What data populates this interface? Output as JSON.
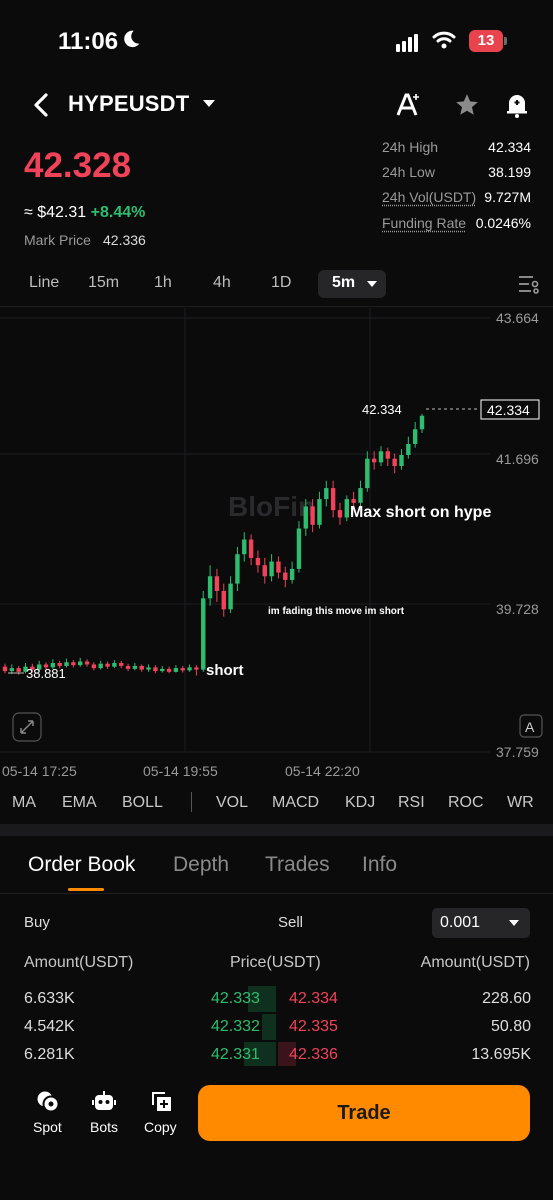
{
  "status_bar": {
    "time": "11:06",
    "battery": "13"
  },
  "header": {
    "pair": "HYPEUSDT"
  },
  "ticker": {
    "last_price": "42.328",
    "usd_prefix": "≈ $42.31",
    "change_pct": "+8.44%",
    "mark_price_label": "Mark Price",
    "mark_price": "42.336"
  },
  "stats": [
    {
      "label": "24h High",
      "value": "42.334"
    },
    {
      "label": "24h Low",
      "value": "38.199"
    },
    {
      "label": "24h Vol(USDT)",
      "value": "9.727M"
    },
    {
      "label": "Funding Rate",
      "value": "0.0246%"
    }
  ],
  "timeframes": [
    "Line",
    "15m",
    "1h",
    "4h",
    "1D"
  ],
  "timeframe_active": "5m",
  "chart_data": {
    "type": "candlestick",
    "y_ticks": [
      "43.664",
      "41.696",
      "39.728",
      "37.759"
    ],
    "x_ticks": [
      "05-14 17:25",
      "05-14 19:55",
      "05-14 22:20"
    ],
    "last_price_label": "42.334",
    "current_price_tag": "42.334",
    "low_label": "38.881",
    "watermark": "BloFin",
    "annotations": [
      "Max short on hype",
      "im fading this move im short",
      "short"
    ],
    "ylim": [
      37.759,
      43.664
    ],
    "candles": [
      [
        38.92,
        38.86,
        38.96,
        38.83
      ],
      [
        38.86,
        38.9,
        38.95,
        38.82
      ],
      [
        38.9,
        38.85,
        38.93,
        38.81
      ],
      [
        38.85,
        38.92,
        38.97,
        38.83
      ],
      [
        38.92,
        38.88,
        38.96,
        38.84
      ],
      [
        38.88,
        38.95,
        39.0,
        38.86
      ],
      [
        38.95,
        38.91,
        38.98,
        38.88
      ],
      [
        38.91,
        38.97,
        39.02,
        38.89
      ],
      [
        38.97,
        38.93,
        39.0,
        38.9
      ],
      [
        38.93,
        38.98,
        39.03,
        38.91
      ],
      [
        38.98,
        38.94,
        39.01,
        38.91
      ],
      [
        38.94,
        38.99,
        39.04,
        38.92
      ],
      [
        38.99,
        38.95,
        39.02,
        38.92
      ],
      [
        38.95,
        38.9,
        38.98,
        38.87
      ],
      [
        38.9,
        38.96,
        39.0,
        38.88
      ],
      [
        38.96,
        38.92,
        38.99,
        38.89
      ],
      [
        38.92,
        38.97,
        39.01,
        38.9
      ],
      [
        38.97,
        38.93,
        39.0,
        38.9
      ],
      [
        38.93,
        38.89,
        38.96,
        38.86
      ],
      [
        38.89,
        38.93,
        38.97,
        38.87
      ],
      [
        38.93,
        38.88,
        38.95,
        38.85
      ],
      [
        38.88,
        38.91,
        38.95,
        38.85
      ],
      [
        38.91,
        38.86,
        38.94,
        38.83
      ],
      [
        38.86,
        38.89,
        38.93,
        38.84
      ],
      [
        38.89,
        38.85,
        38.92,
        38.83
      ],
      [
        38.85,
        38.9,
        38.94,
        38.84
      ],
      [
        38.9,
        38.87,
        38.93,
        38.84
      ],
      [
        38.87,
        38.91,
        38.95,
        38.85
      ],
      [
        38.91,
        38.88,
        38.94,
        38.8
      ],
      [
        38.88,
        39.85,
        39.95,
        38.85
      ],
      [
        39.85,
        40.15,
        40.3,
        39.75
      ],
      [
        40.15,
        39.95,
        40.25,
        39.8
      ],
      [
        39.95,
        39.7,
        40.05,
        39.6
      ],
      [
        39.7,
        40.05,
        40.15,
        39.65
      ],
      [
        40.05,
        40.45,
        40.55,
        39.95
      ],
      [
        40.45,
        40.65,
        40.75,
        40.35
      ],
      [
        40.65,
        40.4,
        40.72,
        40.3
      ],
      [
        40.4,
        40.3,
        40.5,
        40.2
      ],
      [
        40.3,
        40.15,
        40.4,
        40.05
      ],
      [
        40.15,
        40.35,
        40.45,
        40.08
      ],
      [
        40.35,
        40.2,
        40.42,
        40.12
      ],
      [
        40.2,
        40.1,
        40.28,
        40.0
      ],
      [
        40.1,
        40.25,
        40.35,
        40.05
      ],
      [
        40.25,
        40.8,
        40.9,
        40.2
      ],
      [
        40.8,
        41.1,
        41.2,
        40.7
      ],
      [
        41.1,
        40.85,
        41.2,
        40.75
      ],
      [
        40.85,
        41.2,
        41.3,
        40.8
      ],
      [
        41.2,
        41.35,
        41.45,
        41.1
      ],
      [
        41.35,
        41.05,
        41.45,
        40.95
      ],
      [
        41.05,
        40.95,
        41.15,
        40.85
      ],
      [
        40.95,
        41.2,
        41.25,
        40.9
      ],
      [
        41.2,
        41.15,
        41.3,
        41.05
      ],
      [
        41.15,
        41.35,
        41.45,
        41.1
      ],
      [
        41.35,
        41.75,
        41.85,
        41.3
      ],
      [
        41.75,
        41.7,
        41.85,
        41.6
      ],
      [
        41.7,
        41.85,
        41.92,
        41.65
      ],
      [
        41.85,
        41.75,
        41.9,
        41.65
      ],
      [
        41.75,
        41.65,
        41.82,
        41.55
      ],
      [
        41.65,
        41.8,
        41.88,
        41.6
      ],
      [
        41.8,
        41.95,
        42.05,
        41.75
      ],
      [
        41.95,
        42.15,
        42.25,
        41.9
      ],
      [
        42.15,
        42.334,
        42.36,
        42.1
      ]
    ]
  },
  "chart_tools": {
    "expand_label": "",
    "auto_label": "A"
  },
  "indicators": [
    "MA",
    "EMA",
    "BOLL",
    "VOL",
    "MACD",
    "KDJ",
    "RSI",
    "ROC",
    "WR"
  ],
  "tabs": [
    "Order Book",
    "Depth",
    "Trades",
    "Info"
  ],
  "orderbook": {
    "buy_label": "Buy",
    "sell_label": "Sell",
    "precision": "0.001",
    "col_amount_left": "Amount(USDT)",
    "col_price": "Price(USDT)",
    "col_amount_right": "Amount(USDT)",
    "rows": [
      {
        "bid_amount": "6.633K",
        "bid_price": "42.333",
        "ask_price": "42.334",
        "ask_amount": "228.60"
      },
      {
        "bid_amount": "4.542K",
        "bid_price": "42.332",
        "ask_price": "42.335",
        "ask_amount": "50.80"
      },
      {
        "bid_amount": "6.281K",
        "bid_price": "42.331",
        "ask_price": "42.336",
        "ask_amount": "13.695K"
      }
    ]
  },
  "bottom_bar": {
    "spot": "Spot",
    "bots": "Bots",
    "copy": "Copy",
    "trade": "Trade"
  },
  "colors": {
    "up": "#2ebd6f",
    "down": "#f0435a",
    "accent": "#ff8a00"
  }
}
